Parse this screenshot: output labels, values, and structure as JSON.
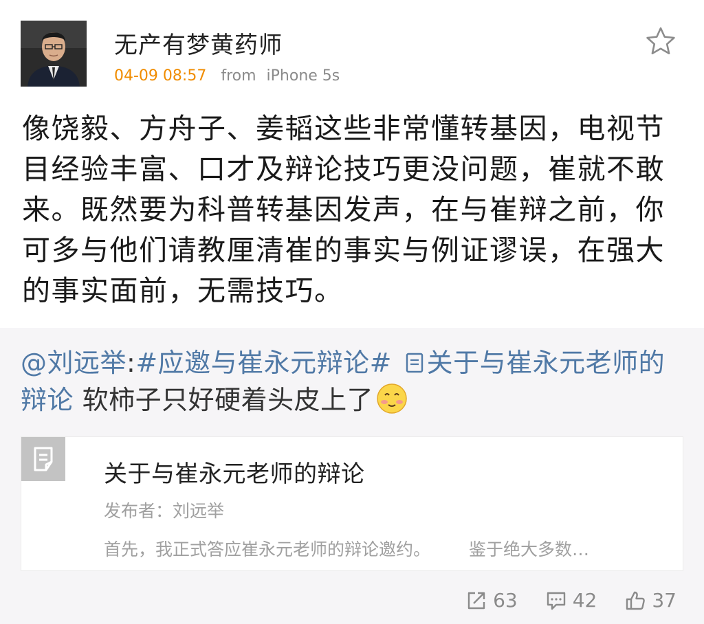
{
  "author": {
    "name": "无产有梦黄药师",
    "time": "04-09 08:57",
    "from_label": "from",
    "device": "iPhone 5s"
  },
  "icons": {
    "favorite": "star-icon",
    "card": "document-icon",
    "repost": "repost-icon",
    "comment": "comment-icon",
    "like": "like-icon"
  },
  "post": {
    "text": "像饶毅、方舟子、姜韬这些非常懂转基因，电视节目经验丰富、口才及辩论技巧更没问题，崔就不敢来。既然要为科普转基因发声，在与崔辩之前，你可多与他们请教厘清崔的事实与例证谬误，在强大的事实面前，无需技巧。"
  },
  "repost": {
    "mention": "@刘远举",
    "colon": ":",
    "hashtag": "#应邀与崔永元辩论#",
    "doc_link": "关于与崔永元老师的辩论",
    "tail": " 软柿子只好硬着头皮上了"
  },
  "card": {
    "title": "关于与崔永元老师的辩论",
    "author": "发布者：刘远举",
    "excerpt_a": "首先，我正式答应崔永元老师的辩论邀约。",
    "excerpt_b": "鉴于绝大多数…"
  },
  "actions": {
    "repost_count": "63",
    "comment_count": "42",
    "like_count": "37"
  },
  "colors": {
    "time": "#f08c00",
    "link": "#5079a6",
    "repost_bg": "#f6f5f7"
  }
}
